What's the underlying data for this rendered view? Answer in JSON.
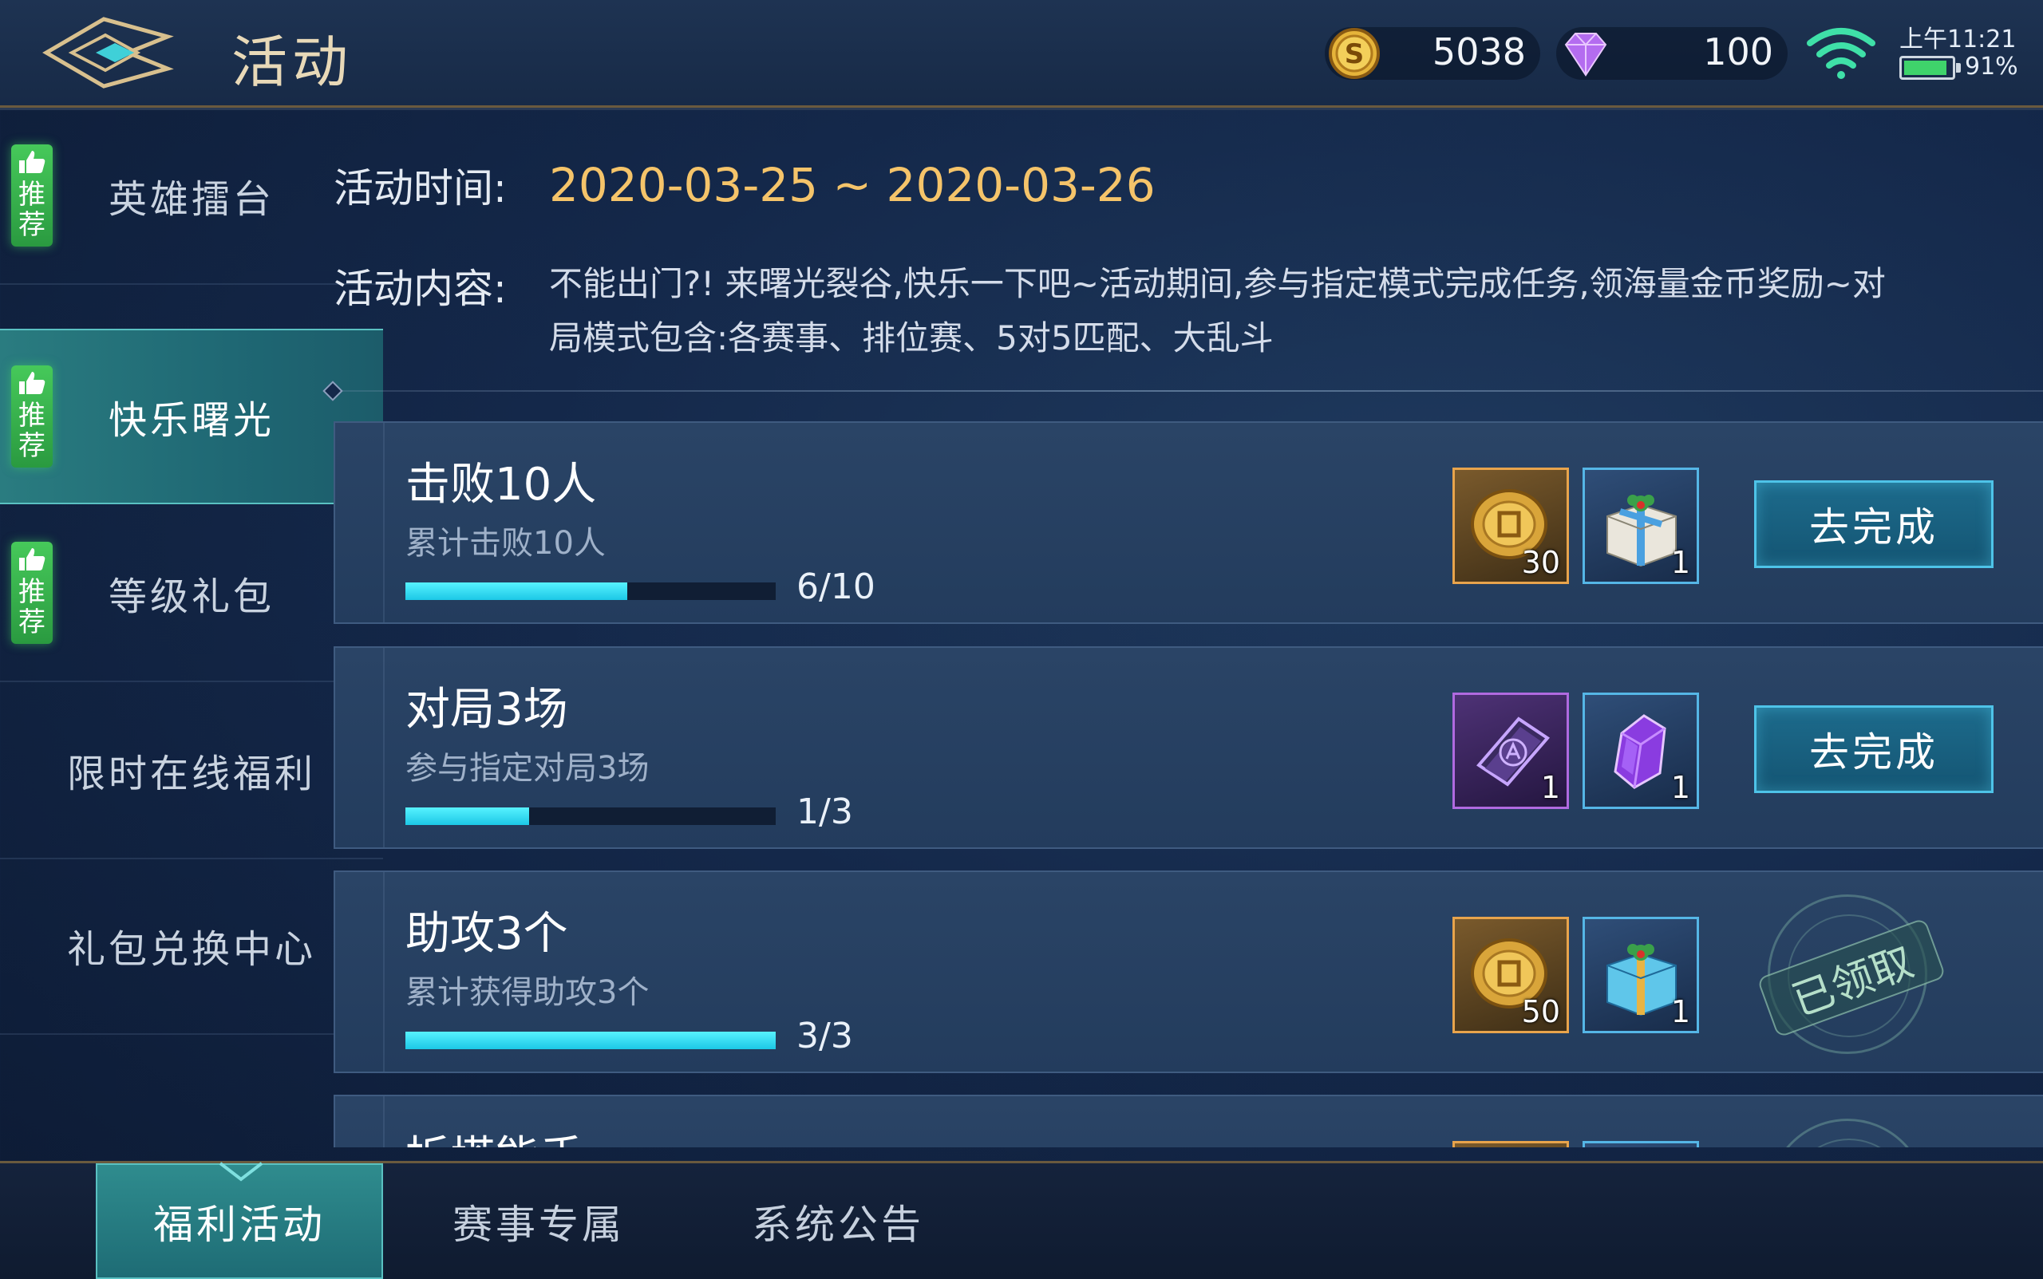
{
  "header": {
    "title": "活动",
    "gold": "5038",
    "gems": "100"
  },
  "status": {
    "time": "上午11:21",
    "battery_pct": "91%",
    "battery_level": 0.91
  },
  "sidebar": {
    "items": [
      {
        "label": "英雄擂台",
        "badge": "推荐",
        "active": false
      },
      {
        "label": "快乐曙光",
        "badge": "推荐",
        "active": true
      },
      {
        "label": "等级礼包",
        "badge": "推荐",
        "active": false
      },
      {
        "label": "限时在线福利",
        "badge": "",
        "active": false
      },
      {
        "label": "礼包兑换中心",
        "badge": "",
        "active": false
      }
    ]
  },
  "info": {
    "time_label": "活动时间:",
    "time_value": "2020-03-25 ~ 2020-03-26",
    "content_label": "活动内容:",
    "content_value": "不能出门?! 来曙光裂谷,快乐一下吧~活动期间,参与指定模式完成任务,领海量金币奖励~对\n局模式包含:各赛事、排位赛、5对5匹配、大乱斗"
  },
  "tasks": [
    {
      "title": "击败10人",
      "desc": "累计击败10人",
      "progress_text": "6/10",
      "progress": 0.6,
      "rewards": [
        {
          "icon": "gold-coin-icon",
          "count": "30"
        },
        {
          "icon": "gift-box-icon",
          "count": "1"
        }
      ],
      "action": "去完成",
      "claimed": false
    },
    {
      "title": "对局3场",
      "desc": "参与指定对局3场",
      "progress_text": "1/3",
      "progress": 0.333,
      "rewards": [
        {
          "icon": "purple-card-icon",
          "count": "1"
        },
        {
          "icon": "purple-crystal-icon",
          "count": "1"
        }
      ],
      "action": "去完成",
      "claimed": false
    },
    {
      "title": "助攻3个",
      "desc": "累计获得助攻3个",
      "progress_text": "3/3",
      "progress": 1.0,
      "rewards": [
        {
          "icon": "gold-coin-icon",
          "count": "50"
        },
        {
          "icon": "gift-box-icon",
          "count": "1"
        }
      ],
      "action": "已领取",
      "claimed": true
    },
    {
      "title": "拆塔能手",
      "desc": "",
      "progress_text": "",
      "progress": 0,
      "rewards": [],
      "action": "",
      "claimed": true
    }
  ],
  "bottom_tabs": [
    {
      "label": "福利活动",
      "active": true
    },
    {
      "label": "赛事专属",
      "active": false
    },
    {
      "label": "系统公告",
      "active": false
    }
  ],
  "colors": {
    "accent_teal": "#2a7c80",
    "date_gold": "#f5c46a",
    "progress_cyan": "#2fd8f0",
    "recommend_green": "#46c95a"
  }
}
